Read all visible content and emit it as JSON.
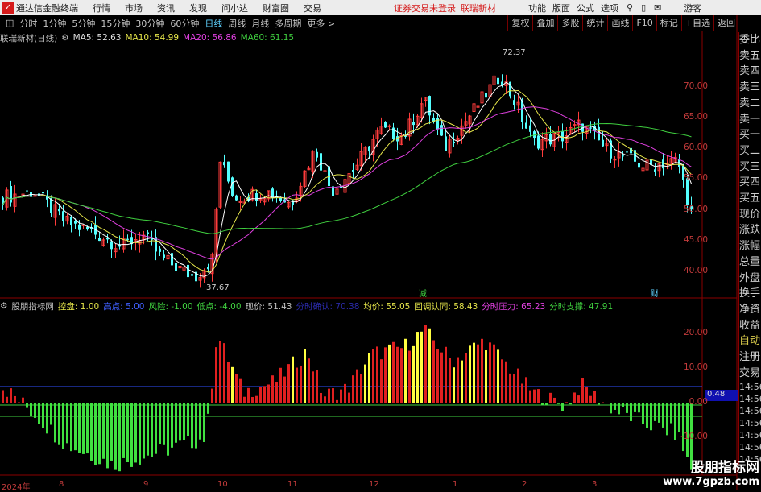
{
  "menubar": {
    "app": "通达信金融终端",
    "items": [
      "行情",
      "市场",
      "资讯",
      "发现",
      "问小达",
      "财富圈",
      "交易"
    ],
    "notice": "证券交易未登录",
    "stock": "联瑞新材",
    "right": [
      "功能",
      "版面",
      "公式",
      "选项"
    ],
    "user": "游客"
  },
  "toolbar": {
    "periods": [
      "分时",
      "1分钟",
      "5分钟",
      "15分钟",
      "30分钟",
      "60分钟",
      "日线",
      "周线",
      "月线",
      "多周期",
      "更多 >"
    ],
    "active": "日线",
    "right": [
      "复权",
      "叠加",
      "多股",
      "统计",
      "画线",
      "F10",
      "标记",
      "+自选",
      "返回"
    ]
  },
  "info": {
    "title": "联瑞新材(日线)",
    "ma5": "MA5: 52.63",
    "ma10": "MA10: 54.99",
    "ma20": "MA20: 56.86",
    "ma60": "MA60: 61.15"
  },
  "colors": {
    "ma5": "#ffffff",
    "ma10": "#e6e64a",
    "ma20": "#e040e0",
    "ma60": "#3fcf3f",
    "up": "#ff3c3c",
    "down": "#54ffff"
  },
  "annotations": {
    "high": "72.37",
    "low": "37.67",
    "mark1": "减",
    "mark2": "财"
  },
  "price_axis": [
    "70.00",
    "65.00",
    "60.00",
    "55.00",
    "50.00",
    "45.00",
    "40.00"
  ],
  "indicator": {
    "name": "股朋指标网",
    "items": [
      {
        "t": "控盘: 1.00",
        "c": "#e6e64a"
      },
      {
        "t": "高点: 5.00",
        "c": "#4060ff"
      },
      {
        "t": "风险: -1.00",
        "c": "#3fcf3f"
      },
      {
        "t": "低点: -4.00",
        "c": "#3fcf3f"
      },
      {
        "t": "现价: 51.43",
        "c": "#c0c0c0"
      },
      {
        "t": "分时确认: 70.38",
        "c": "#2a2aa8"
      },
      {
        "t": "均价: 55.05",
        "c": "#e6e64a"
      },
      {
        "t": "回调认同: 58.43",
        "c": "#e6e64a"
      },
      {
        "t": "分时压力: 65.23",
        "c": "#e040e0"
      },
      {
        "t": "分时支撑: 47.91",
        "c": "#3fcf3f"
      }
    ],
    "axis": [
      "20.00",
      "10.00",
      "0.00",
      "-10.00"
    ],
    "value_tag": "0.48"
  },
  "right_panel": {
    "items": [
      "委比",
      "卖五",
      "卖四",
      "卖三",
      "卖二",
      "卖一",
      "买一",
      "买二",
      "买三",
      "买四",
      "买五",
      "现价",
      "涨跌",
      "涨幅",
      "总量",
      "外盘",
      "换手",
      "净资",
      "收益"
    ],
    "auto": "自动",
    "extra": [
      "注册",
      "交易"
    ],
    "times": [
      "14:56",
      "14:56",
      "14:56",
      "14:56",
      "14:56",
      "14:56",
      "14:56"
    ]
  },
  "dates": [
    "2024年",
    "8",
    "9",
    "10",
    "11",
    "12",
    "1",
    "2",
    "3"
  ],
  "watermark": {
    "name": "股朋指标网",
    "url": "www.7gpzb.com"
  },
  "chart_data": {
    "type": "candlestick",
    "price_keys": [
      [
        0,
        52
      ],
      [
        40,
        53
      ],
      [
        80,
        48
      ],
      [
        120,
        46
      ],
      [
        150,
        44
      ],
      [
        175,
        46
      ],
      [
        200,
        42
      ],
      [
        240,
        39
      ],
      [
        262,
        42
      ],
      [
        272,
        58
      ],
      [
        290,
        52
      ],
      [
        330,
        53
      ],
      [
        360,
        51
      ],
      [
        390,
        60
      ],
      [
        410,
        53
      ],
      [
        440,
        57
      ],
      [
        470,
        63
      ],
      [
        500,
        62
      ],
      [
        525,
        68
      ],
      [
        550,
        60
      ],
      [
        580,
        65
      ],
      [
        620,
        72
      ],
      [
        640,
        67
      ],
      [
        660,
        61
      ],
      [
        700,
        62
      ],
      [
        720,
        64
      ],
      [
        750,
        60
      ],
      [
        800,
        57
      ],
      [
        840,
        58
      ],
      [
        858,
        49
      ]
    ],
    "ind_keys": [
      [
        0,
        5
      ],
      [
        40,
        -3
      ],
      [
        80,
        -12
      ],
      [
        140,
        -18
      ],
      [
        200,
        -14
      ],
      [
        255,
        -10
      ],
      [
        268,
        20
      ],
      [
        300,
        3
      ],
      [
        340,
        6
      ],
      [
        380,
        15
      ],
      [
        400,
        2
      ],
      [
        430,
        4
      ],
      [
        460,
        14
      ],
      [
        500,
        16
      ],
      [
        525,
        21
      ],
      [
        560,
        12
      ],
      [
        600,
        18
      ],
      [
        640,
        8
      ],
      [
        660,
        3
      ],
      [
        700,
        -1
      ],
      [
        720,
        5
      ],
      [
        760,
        -2
      ],
      [
        800,
        -6
      ],
      [
        840,
        -9
      ],
      [
        858,
        -20
      ]
    ]
  }
}
